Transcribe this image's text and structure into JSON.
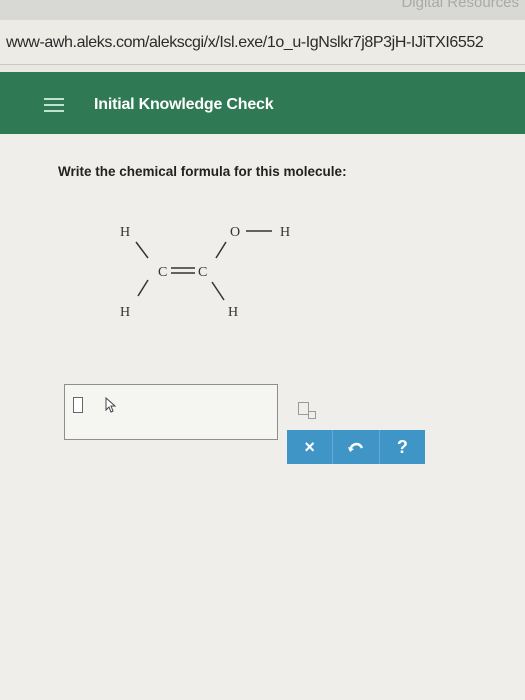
{
  "browser": {
    "top_right_text": "Digital Resources",
    "url": "www-awh.aleks.com/alekscgi/x/Isl.exe/1o_u-IgNslkr7j8P3jH-IJiTXI6552"
  },
  "header": {
    "menu_icon": "hamburger-menu-icon",
    "title": "Initial Knowledge Check",
    "color": "#2f7a55"
  },
  "question": {
    "prompt": "Write the chemical formula for this molecule:"
  },
  "molecule": {
    "atoms": {
      "h_top_left": "H",
      "h_bottom_left": "H",
      "c_left": "C",
      "c_right": "C",
      "o": "O",
      "h_on_o": "H",
      "h_bottom_right": "H"
    }
  },
  "answer": {
    "value": "",
    "input_icon": "text-cursor-box-icon",
    "pointer_icon": "mouse-pointer-icon",
    "subscript_tool_icon": "subscript-icon"
  },
  "buttons": {
    "clear_label": "×",
    "undo_icon": "undo-icon",
    "help_label": "?",
    "color": "#3f95c6"
  }
}
